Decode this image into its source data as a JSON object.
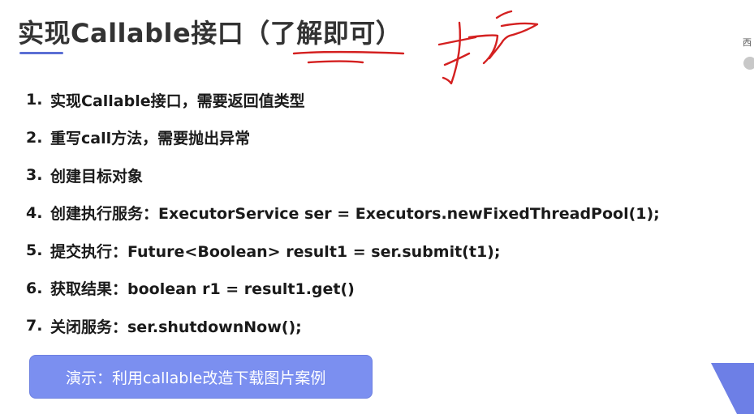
{
  "slide": {
    "title": "实现Callable接口（了解即可）"
  },
  "steps": [
    {
      "num": "1.",
      "text": "实现Callable接口，需要返回值类型"
    },
    {
      "num": "2.",
      "text": "重写call方法，需要抛出异常"
    },
    {
      "num": "3.",
      "text": "创建目标对象"
    },
    {
      "num": "4.",
      "text": "创建执行服务：ExecutorService ser = Executors.newFixedThreadPool(1);"
    },
    {
      "num": "5.",
      "text": "提交执行：Future<Boolean> result1 = ser.submit(t1);"
    },
    {
      "num": "6.",
      "text": "获取结果：boolean r1 = result1.get()"
    },
    {
      "num": "7.",
      "text": "关闭服务：ser.shutdownNow();"
    }
  ],
  "demo_button": {
    "label": "演示：利用callable改造下载图片案例"
  },
  "edge": {
    "char": "西"
  },
  "colors": {
    "accent": "#5b6fd4",
    "button": "#7b8ff0",
    "ink": "#d42020",
    "corner": "#6d7fe6"
  }
}
